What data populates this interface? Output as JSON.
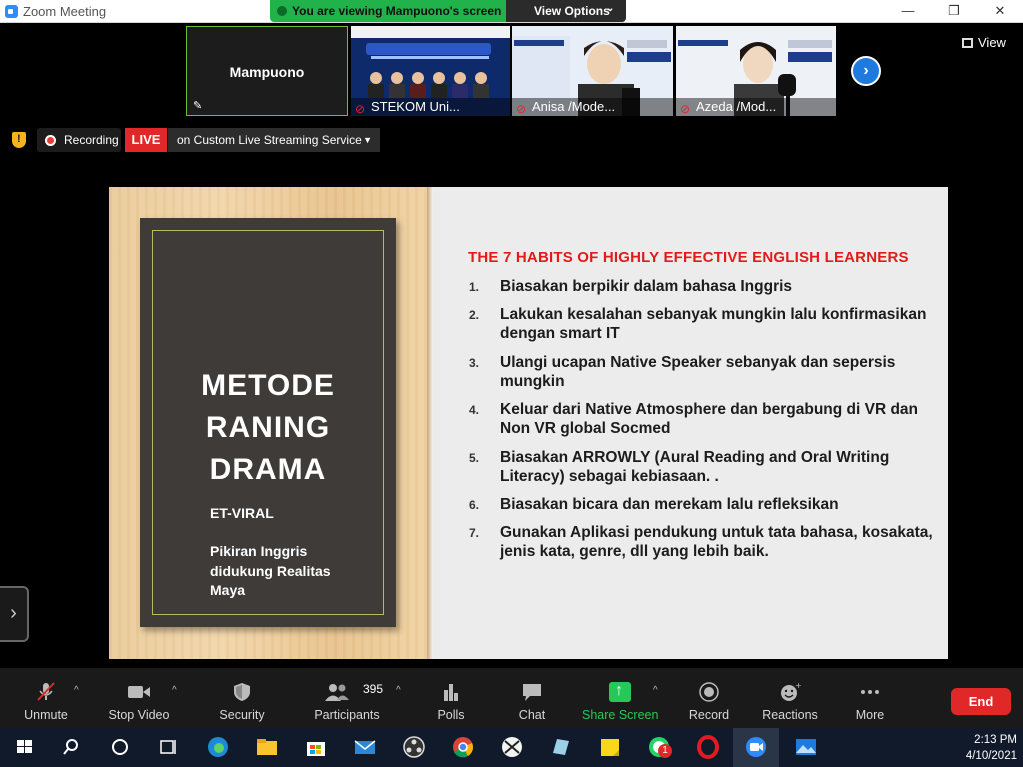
{
  "window": {
    "title": "Zoom Meeting",
    "share_banner": "You are viewing Mampuono's screen",
    "view_options": "View Options",
    "minimize": "—",
    "maximize": "❐",
    "close": "✕"
  },
  "participants_strip": {
    "self_name": "Mampuono",
    "tiles": [
      {
        "label": "STEKOM Uni..."
      },
      {
        "label": "Anisa /Mode..."
      },
      {
        "label": "Azeda /Mod..."
      }
    ],
    "view_label": "View"
  },
  "status_bar": {
    "recording": "Recording",
    "live": "LIVE",
    "stream": "on Custom Live Streaming Service"
  },
  "slide": {
    "board_title": [
      "METODE",
      "RANING",
      "DRAMA"
    ],
    "board_subtitle": "ET-VIRAL",
    "board_text": "Pikiran Inggris didukung Realitas Maya",
    "heading": "THE 7 HABITS OF HIGHLY EFFECTIVE ENGLISH LEARNERS",
    "items": [
      {
        "num": "1.",
        "text": "Biasakan berpikir dalam bahasa Inggris"
      },
      {
        "num": "2.",
        "text": "Lakukan kesalahan sebanyak mungkin lalu konfirmasikan dengan smart IT"
      },
      {
        "num": "3.",
        "text": "Ulangi  ucapan Native Speaker sebanyak dan sepersis mungkin"
      },
      {
        "num": "4.",
        "text": "Keluar dari Native Atmosphere dan bergabung di VR dan Non VR global Socmed"
      },
      {
        "num": "5.",
        "text": "Biasakan ARROWLY (Aural Reading and Oral Writing Literacy) sebagai kebiasaan. ."
      },
      {
        "num": "6.",
        "text": "Biasakan bicara dan merekam lalu refleksikan"
      },
      {
        "num": "7.",
        "text": "Gunakan Aplikasi pendukung untuk tata bahasa, kosakata, jenis kata, genre, dll yang lebih baik."
      }
    ]
  },
  "toolbar": {
    "unmute": "Unmute",
    "stop_video": "Stop Video",
    "security": "Security",
    "participants": "Participants",
    "participant_count": "395",
    "polls": "Polls",
    "chat": "Chat",
    "share_screen": "Share Screen",
    "record": "Record",
    "reactions": "Reactions",
    "more": "More",
    "end": "End"
  },
  "taskbar": {
    "time": "2:13 PM",
    "date": "4/10/2021",
    "whatsapp_badge": "1"
  },
  "colors": {
    "live_red": "#e02828",
    "share_green": "#22b24c",
    "slide_heading_red": "#e11b1b",
    "accent_blue": "#1f7ae0"
  }
}
